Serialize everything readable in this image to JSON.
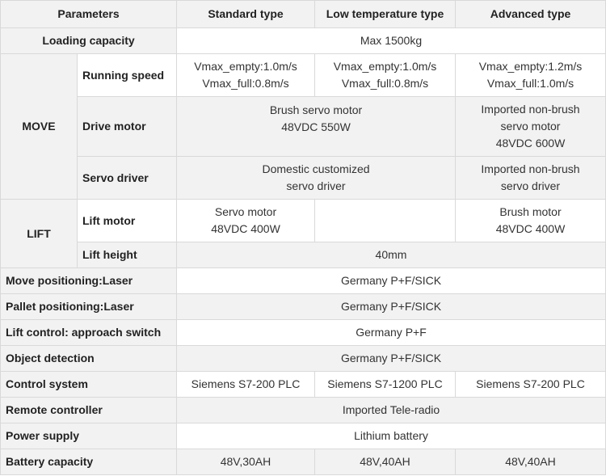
{
  "headers": {
    "parameters": "Parameters",
    "standard": "Standard type",
    "low_temp": "Low temperature type",
    "advanced": "Advanced type"
  },
  "loading_capacity": {
    "label": "Loading capacity",
    "value": "Max 1500kg"
  },
  "move": {
    "label": "MOVE",
    "running_speed": {
      "label": "Running speed",
      "standard": [
        "Vmax_empty:1.0m/s",
        "Vmax_full:0.8m/s"
      ],
      "low_temp": [
        "Vmax_empty:1.0m/s",
        "Vmax_full:0.8m/s"
      ],
      "advanced": [
        "Vmax_empty:1.2m/s",
        "Vmax_full:1.0m/s"
      ]
    },
    "drive_motor": {
      "label": "Drive motor",
      "standard_low": [
        "Brush servo motor",
        "48VDC 550W"
      ],
      "advanced": [
        "Imported non-brush",
        "servo motor",
        "48VDC 600W"
      ]
    },
    "servo_driver": {
      "label": "Servo driver",
      "standard_low": [
        "Domestic customized",
        "servo driver"
      ],
      "advanced": [
        "Imported non-brush",
        "servo driver"
      ]
    }
  },
  "lift": {
    "label": "LIFT",
    "lift_motor": {
      "label": "Lift motor",
      "standard": [
        "Servo motor",
        "48VDC 400W"
      ],
      "low_temp": "",
      "advanced": [
        "Brush motor",
        "48VDC 400W"
      ]
    },
    "lift_height": {
      "label": "Lift height",
      "value": "40mm"
    }
  },
  "rows": [
    {
      "label": "Move positioning:Laser",
      "value": "Germany P+F/SICK"
    },
    {
      "label": "Pallet positioning:Laser",
      "value": "Germany P+F/SICK"
    },
    {
      "label": "Lift control: approach switch",
      "value": "Germany P+F"
    },
    {
      "label": "Object detection",
      "value": "Germany P+F/SICK"
    }
  ],
  "control_system": {
    "label": "Control system",
    "standard": "Siemens S7-200 PLC",
    "low_temp": "Siemens S7-1200 PLC",
    "advanced": "Siemens S7-200 PLC"
  },
  "remote_controller": {
    "label": "Remote controller",
    "value": "Imported Tele-radio"
  },
  "power_supply": {
    "label": "Power supply",
    "value": "Lithium battery"
  },
  "battery_capacity": {
    "label": "Battery capacity",
    "standard": "48V,30AH",
    "low_temp": "48V,40AH",
    "advanced": "48V,40AH"
  }
}
